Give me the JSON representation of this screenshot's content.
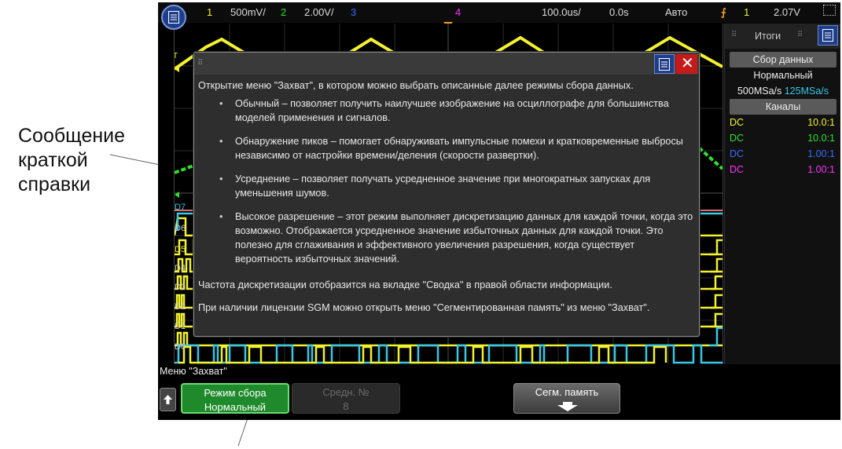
{
  "callout": {
    "lines": [
      "Сообщение",
      "краткой",
      "справки"
    ]
  },
  "status_bar": {
    "ch1_num": "1",
    "ch1_scale": "500mV/",
    "ch2_num": "2",
    "ch2_scale": "2.00V/",
    "ch3_num": "3",
    "ch4_num": "4",
    "timebase": "100.0us/",
    "delay": "0.0s",
    "trigger_mode": "Авто",
    "trigger_channel": "1",
    "trigger_level": "2.07V"
  },
  "colors": {
    "ch1": "#f2f230",
    "ch2": "#30e030",
    "ch3": "#3a6cff",
    "ch4": "#ff30ff",
    "digital": "#38c8e8",
    "trigger": "#f0a020"
  },
  "digital_channels": [
    "D7",
    "D6",
    "D5",
    "D4",
    "D3",
    "D2",
    "D1",
    "D0"
  ],
  "right_panel": {
    "tab_title": "Итоги",
    "acq_header": "Сбор данных",
    "acq_mode": "Нормальный",
    "rate_main": "500MSa/s",
    "rate_digital": "125MSa/s",
    "channels_header": "Каналы",
    "channels": [
      {
        "coupling": "DC",
        "probe": "10.0:1"
      },
      {
        "coupling": "DC",
        "probe": "10.0:1"
      },
      {
        "coupling": "DC",
        "probe": "1.00:1"
      },
      {
        "coupling": "DC",
        "probe": "1.00:1"
      }
    ]
  },
  "help_dialog": {
    "intro": "Открытие меню \"Захват\", в котором можно выбрать описанные далее режимы сбора данных.",
    "items": [
      "Обычный – позволяет получить наилучшее изображение на осциллографе для большинства моделей применения и сигналов.",
      "Обнаружение пиков – помогает обнаруживать импульсные помехи и кратковременные выбросы независимо от настройки времени/деления (скорости развертки).",
      "Усреднение – позволяет получать усредненное значение при многократных запусках для уменьшения шумов.",
      "Высокое разрешение – этот режим выполняет дискретизацию данных для каждой точки, когда это возможно. Отображается усредненное значение избыточных данных для каждой точки. Это полезно для сглаживания и эффективного увеличения разрешения, когда существует вероятность избыточных значений."
    ],
    "note1": "Частота дискретизации отобразится на вкладке \"Сводка\" в правой области информации.",
    "note2": "При наличии лицензии SGM можно открыть меню \"Сегментированная память\" из меню \"Захват\"."
  },
  "softkeys": {
    "menu_label": "Меню \"Захват\"",
    "acq_mode_label": "Режим сбора",
    "acq_mode_value": "Нормальный",
    "avg_label": "Средн. №",
    "avg_value": "8",
    "seg_label": "Сегм. память"
  }
}
